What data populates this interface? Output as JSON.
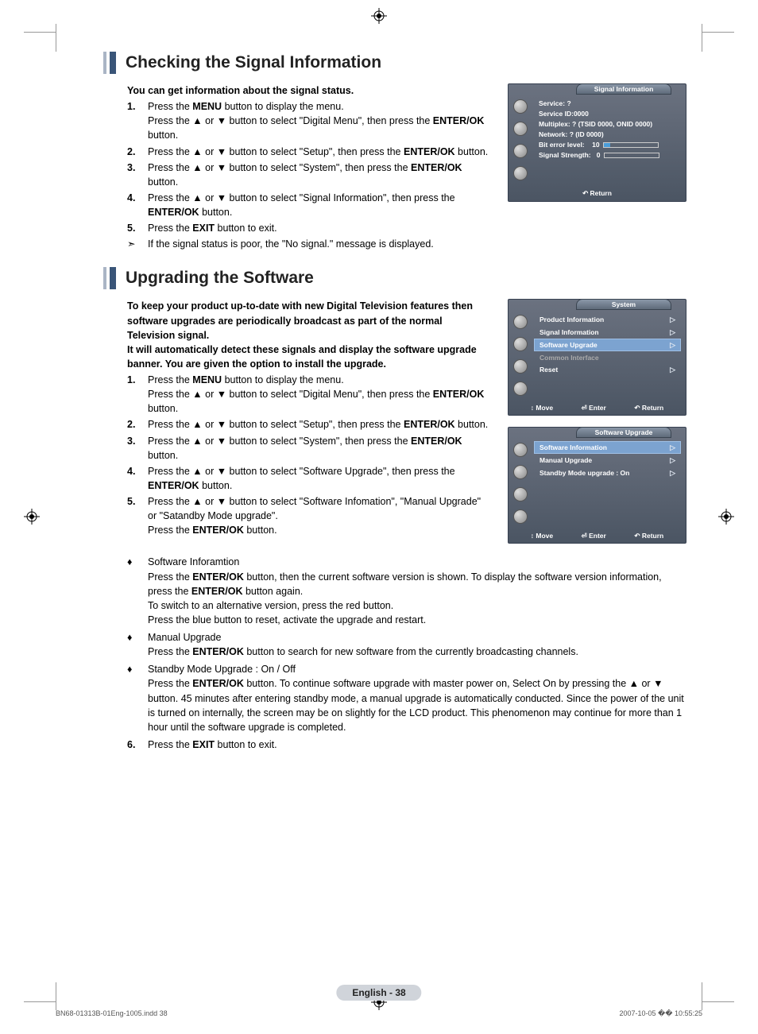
{
  "section1": {
    "title": "Checking the Signal Information",
    "intro": "You can get information about the signal status.",
    "steps": [
      {
        "n": "1.",
        "t": "Press the <b>MENU</b> button to display the menu.<br>Press the ▲ or ▼ button to select \"Digital Menu\", then press the <b>ENTER/OK</b> button."
      },
      {
        "n": "2.",
        "t": "Press the ▲ or ▼ button to select \"Setup\", then press the <b>ENTER/OK</b> button."
      },
      {
        "n": "3.",
        "t": "Press the ▲ or ▼ button to select \"System\", then press the <b>ENTER/OK</b> button."
      },
      {
        "n": "4.",
        "t": "Press the ▲ or ▼ button to select \"Signal Information\", then press the <b>ENTER/OK</b> button."
      },
      {
        "n": "5.",
        "t": "Press the <b>EXIT</b> button to exit."
      }
    ],
    "note": "If the signal status is poor, the \"No signal.\" message is displayed."
  },
  "section2": {
    "title": "Upgrading the Software",
    "intro": "To keep your product up-to-date with new Digital Television features then software upgrades are periodically broadcast as part of the normal Television signal.<br>It will automatically detect these signals and display the software upgrade banner. You are given the option to install the upgrade.",
    "steps": [
      {
        "n": "1.",
        "t": "Press the <b>MENU</b> button to display the menu.<br>Press the ▲ or ▼ button to select \"Digital Menu\", then press the <b>ENTER/OK</b> button."
      },
      {
        "n": "2.",
        "t": "Press the ▲ or ▼ button to select \"Setup\", then press the <b>ENTER/OK</b> button."
      },
      {
        "n": "3.",
        "t": "Press the ▲ or ▼ button to select \"System\", then press the <b>ENTER/OK</b> button."
      },
      {
        "n": "4.",
        "t": "Press the ▲ or ▼ button to select \"Software Upgrade\", then press the <b>ENTER/OK</b> button."
      },
      {
        "n": "5.",
        "t": "Press the ▲ or ▼ button to select \"Software Infomation\", \"Manual Upgrade\" or \"Satandby Mode upgrade\".<br>Press the <b>ENTER/OK</b> button."
      }
    ],
    "bullets": [
      {
        "head": "Software Inforamtion",
        "body": "Press the <b>ENTER/OK</b> button, then the current software version is shown. To display the software version information, press the <b>ENTER/OK</b> button again.<br>To switch to an alternative version, press the red button.<br>Press the blue button to reset, activate the upgrade and restart."
      },
      {
        "head": "Manual Upgrade",
        "body": "Press the <b>ENTER/OK</b> button to search for new software from the currently broadcasting channels."
      },
      {
        "head": "Standby Mode Upgrade : On / Off",
        "body": "Press the <b>ENTER/OK</b> button. To continue software upgrade with master power on, Select On by pressing the ▲ or ▼ button. 45 minutes after entering standby mode, a manual upgrade is automatically conducted. Since the power of the unit is turned on internally, the screen may be on slightly for the LCD product. This phenomenon may continue for more than 1 hour until the software upgrade is completed."
      }
    ],
    "step6": {
      "n": "6.",
      "t": "Press the <b>EXIT</b> button to exit."
    }
  },
  "tv1": {
    "title": "Signal Information",
    "rows": [
      "Service: ?",
      "Service ID:0000",
      "Multiplex: ? (TSID 0000, ONID 0000)",
      "Network: ? (ID 0000)"
    ],
    "bitErrorLabel": "Bit error level:",
    "bitErrorVal": "10",
    "bitErrorPct": 12,
    "sigStrengthLabel": "Signal Strength:",
    "sigStrengthVal": "0",
    "sigStrengthPct": 0,
    "footer": "↶ Return"
  },
  "tv2": {
    "title": "System",
    "items": [
      {
        "label": "Product Information",
        "sel": false,
        "dim": false,
        "arrow": true
      },
      {
        "label": "Signal Information",
        "sel": false,
        "dim": false,
        "arrow": true
      },
      {
        "label": "Software Upgrade",
        "sel": true,
        "dim": false,
        "arrow": true
      },
      {
        "label": "Common Interface",
        "sel": false,
        "dim": true,
        "arrow": false
      },
      {
        "label": "Reset",
        "sel": false,
        "dim": false,
        "arrow": true
      }
    ],
    "footer": {
      "move": "↕ Move",
      "enter": "⏎ Enter",
      "ret": "↶ Return"
    }
  },
  "tv3": {
    "title": "Software Upgrade",
    "items": [
      {
        "label": "Software Information",
        "sel": true,
        "arrow": true
      },
      {
        "label": "Manual Upgrade",
        "sel": false,
        "arrow": true
      },
      {
        "label": "Standby Mode upgrade : On",
        "sel": false,
        "arrow": true
      }
    ],
    "footer": {
      "move": "↕ Move",
      "enter": "⏎ Enter",
      "ret": "↶ Return"
    }
  },
  "pageBadge": "English - 38",
  "footer": {
    "left": "BN68-01313B-01Eng-1005.indd   38",
    "right": "2007-10-05   �� 10:55:25"
  }
}
